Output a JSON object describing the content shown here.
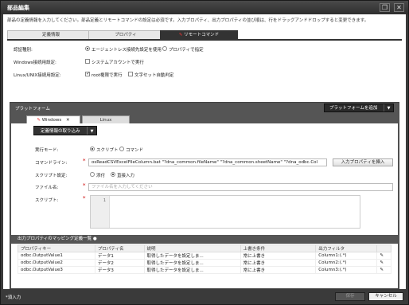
{
  "window": {
    "title": "部品編集",
    "restore_icon": "restore-icon",
    "close_icon": "close-icon"
  },
  "note": "部品の定義情報を入力してください。部品定義とリモートコマンドの設定は必須です。入力プロパティ、出力プロパティの並び順は、行をドラッグアンドドロップすると変更できます。",
  "tabs": [
    {
      "label": "定義情報"
    },
    {
      "label": "プロパティ"
    },
    {
      "label": "リモートコマンド"
    }
  ],
  "form": {
    "auth_label": "認証種別:",
    "auth_opt1": "エージェントレス接続先設定を使用",
    "auth_opt2": "プロパティで指定",
    "win_label": "Windows接続用設定:",
    "win_chk": "システムアカウントで実行",
    "unix_label": "Linux/UNIX接続用設定:",
    "unix_chk1": "root権限で実行",
    "unix_chk2": "文字セット自動判定"
  },
  "platform": {
    "title": "プラットフォーム",
    "add_label": "プラットフォームを追加",
    "tab_windows": "Windows",
    "tab_linux": "Linux",
    "load_def": "定義情報の取り込み",
    "exec_mode_label": "実行モード:",
    "exec_script": "スクリプト",
    "exec_command": "コマンド",
    "cmdline_label": "コマンドライン:",
    "cmdline_value": "osReadCSVExcelFileColumn.bat \"?dna_common.fileName\" \"?dna_common.sheetName\" \"?dna_odbc.Col",
    "insert_prop": "入力プロパティを挿入",
    "script_setting_label": "スクリプト設定:",
    "attach": "添付",
    "direct_input": "直接入力",
    "filename_label": "ファイル名:",
    "filename_placeholder": "ファイル名を入力してください",
    "script_label": "スクリプト:",
    "line_no": "1"
  },
  "mapping": {
    "title": "出力プロパティのマッピング定義一覧",
    "columns": [
      "プロパティキー",
      "プロパティ名",
      "説明",
      "上書き条件",
      "出力フィルタ"
    ],
    "rows": [
      [
        "odbc.OutputValue1",
        "データ1",
        "取得したデータを設定しま...",
        "常に上書き",
        "Column1:(.*)"
      ],
      [
        "odbc.OutputValue2",
        "データ2",
        "取得したデータを設定しま...",
        "常に上書き",
        "Column2:(.*)"
      ],
      [
        "odbc.OutputValue3",
        "データ3",
        "取得したデータを設定しま...",
        "常に上書き",
        "Column3:(.*)"
      ]
    ]
  },
  "footer": {
    "required_note": "*須入力",
    "save": "保存",
    "cancel": "キャンセル"
  }
}
